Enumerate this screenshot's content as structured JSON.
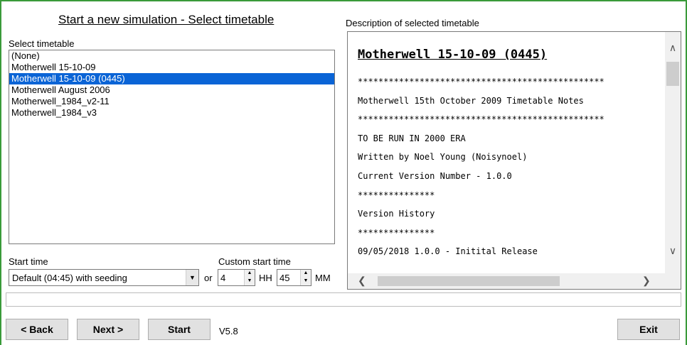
{
  "header": {
    "title": "Start a new simulation - Select timetable"
  },
  "timetable_list": {
    "label": "Select timetable",
    "items": [
      {
        "label": "(None)",
        "selected": false
      },
      {
        "label": "Motherwell 15-10-09",
        "selected": false
      },
      {
        "label": "Motherwell 15-10-09 (0445)",
        "selected": true
      },
      {
        "label": "Motherwell August 2006",
        "selected": false
      },
      {
        "label": "Motherwell_1984_v2-11",
        "selected": false
      },
      {
        "label": "Motherwell_1984_v3",
        "selected": false
      }
    ]
  },
  "start_time": {
    "label": "Start time",
    "value": "Default (04:45) with seeding",
    "or_label": "or"
  },
  "custom_start": {
    "label": "Custom start time",
    "hours": "4",
    "hours_unit": "HH",
    "minutes": "45",
    "minutes_unit": "MM"
  },
  "description": {
    "label": "Description of selected timetable",
    "heading": "Motherwell 15-10-09 (0445)",
    "lines": [
      "************************************************",
      "Motherwell 15th October 2009 Timetable Notes",
      "************************************************",
      "TO BE RUN IN 2000 ERA",
      "Written by Noel Young (Noisynoel)",
      "Current Version Number - 1.0.0",
      "***************",
      "Version History",
      "***************",
      "09/05/2018 1.0.0 - Initital Release"
    ]
  },
  "buttons": {
    "back": "< Back",
    "next": "Next >",
    "start": "Start",
    "exit": "Exit"
  },
  "version": "V5.8",
  "icons": {
    "dropdown": "chevron-down-icon",
    "scroll_up": "chevron-up-icon",
    "scroll_down": "chevron-down-icon",
    "scroll_left": "chevron-left-icon",
    "scroll_right": "chevron-right-icon"
  },
  "colors": {
    "selection": "#0a64d6",
    "window_border": "#3a9a3a"
  }
}
